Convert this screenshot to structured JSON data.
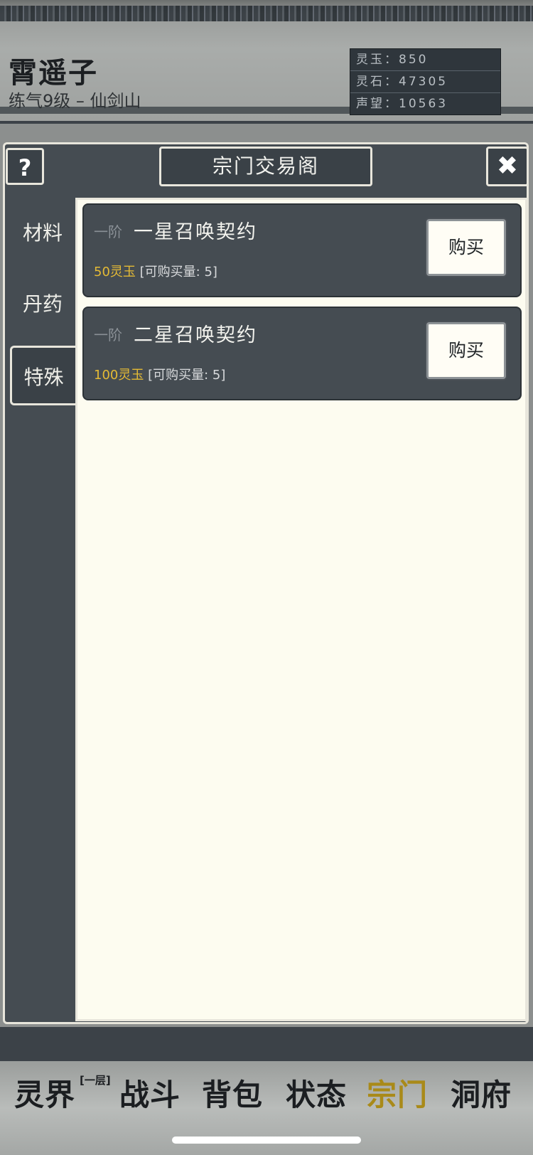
{
  "header": {
    "name": "霄遥子",
    "subtitle": "练气9级 – 仙剑山",
    "stats": [
      {
        "label": "灵玉：",
        "value": "850"
      },
      {
        "label": "灵石：",
        "value": "47305"
      },
      {
        "label": "声望：",
        "value": "10563"
      }
    ]
  },
  "panel": {
    "help_label": "?",
    "title": "宗门交易阁",
    "close_label": "✖"
  },
  "tabs": [
    {
      "label": "材料",
      "active": false
    },
    {
      "label": "丹药",
      "active": false
    },
    {
      "label": "特殊",
      "active": true
    }
  ],
  "items": [
    {
      "rank": "一阶",
      "name": "一星召唤契约",
      "price": "50灵玉",
      "limit": "[可购买量: 5]",
      "button": "购买"
    },
    {
      "rank": "一阶",
      "name": "二星召唤契约",
      "price": "100灵玉",
      "limit": "[可购买量: 5]",
      "button": "购买"
    }
  ],
  "nav": {
    "items": [
      {
        "label": "灵界",
        "active": false
      },
      {
        "label": "战斗",
        "active": false
      },
      {
        "label": "背包",
        "active": false
      },
      {
        "label": "状态",
        "active": false
      },
      {
        "label": "宗门",
        "active": true
      },
      {
        "label": "洞府",
        "active": false
      }
    ],
    "realm_badge": "[一层]"
  },
  "colors": {
    "panel_bg": "#454c52",
    "content_bg": "#fdfcf0",
    "price_gold": "#e4ba35",
    "active_nav": "#a98a19"
  }
}
